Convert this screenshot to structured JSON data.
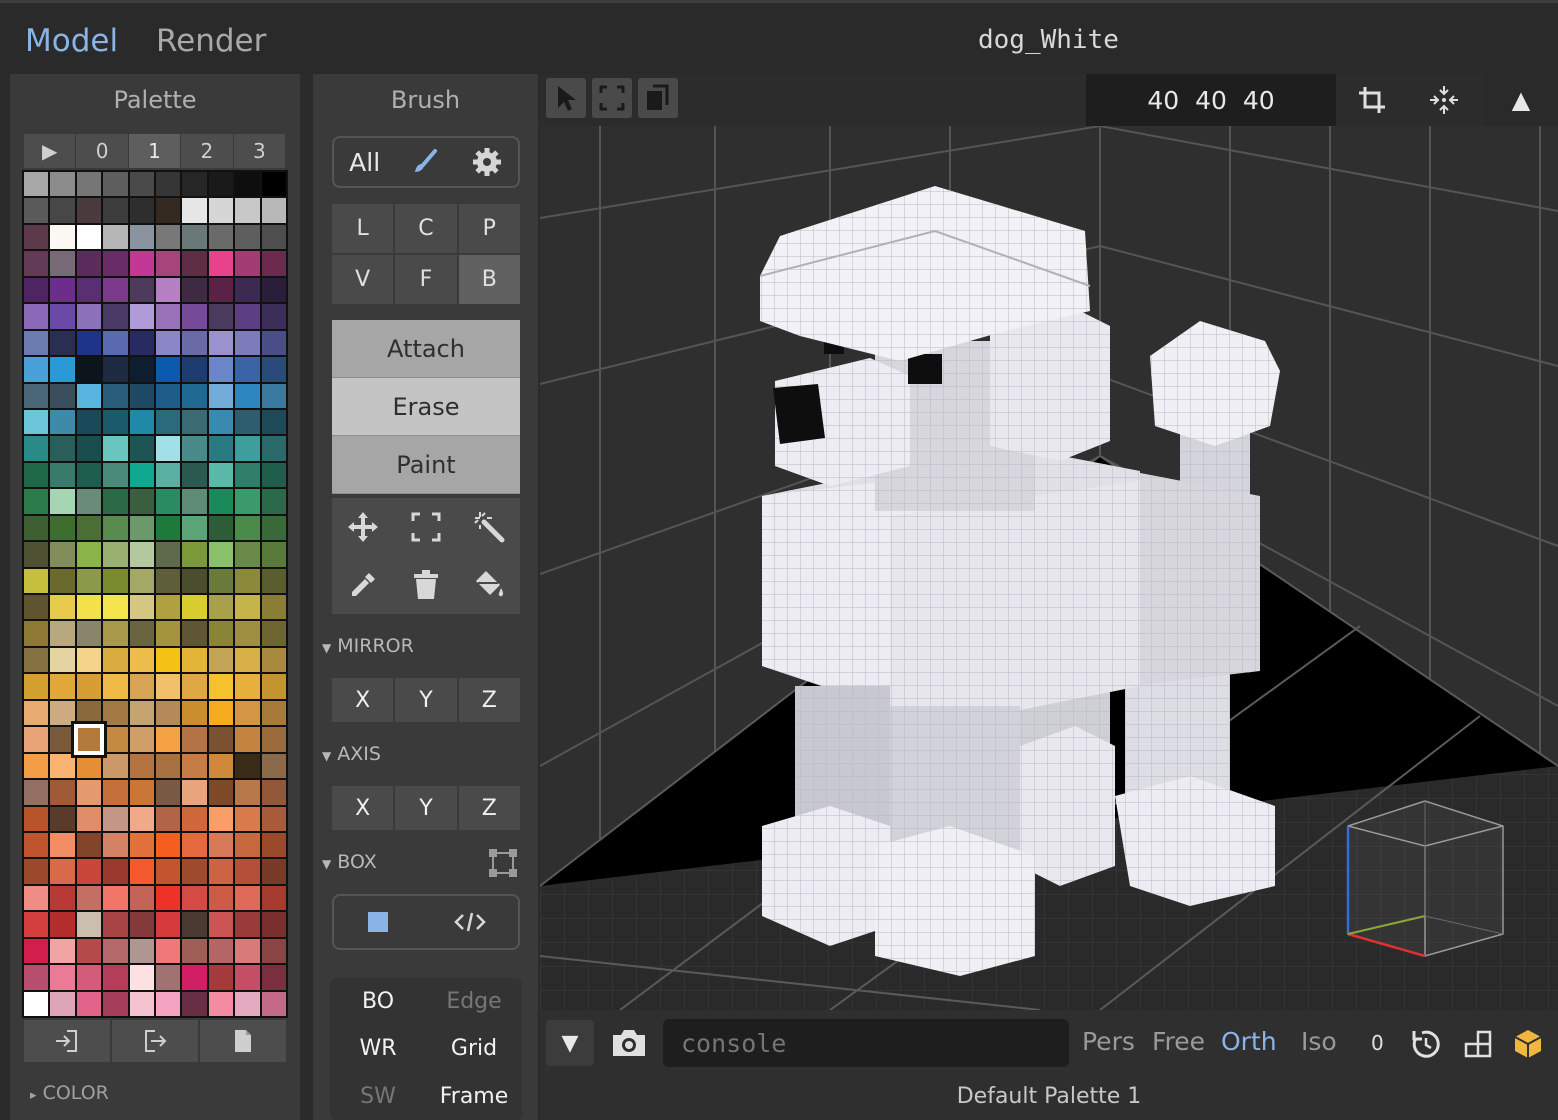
{
  "app": {
    "modes": [
      "Model",
      "Render"
    ],
    "active_mode": "Model",
    "document_title": "dog_White"
  },
  "palette": {
    "title": "Palette",
    "tabs": [
      "▶",
      "0",
      "1",
      "2",
      "3"
    ],
    "active_tab": "1",
    "selected_index": 212,
    "colors": [
      "#a8a8a8",
      "#8c8c8c",
      "#767676",
      "#5e5e5e",
      "#4a4a4a",
      "#363636",
      "#262626",
      "#1a1a1a",
      "#0e0e0e",
      "#000000",
      "#5a5a5a",
      "#474747",
      "#4a3c3c",
      "#3c3c3c",
      "#2e2e2e",
      "#352a22",
      "#e6e6e6",
      "#d6d6d6",
      "#c8c8c8",
      "#b8b8b8",
      "#5c3a4a",
      "#fbf7f2",
      "#ffffff",
      "#b6b6b6",
      "#8a93a0",
      "#787878",
      "#6a7878",
      "#6a6a6a",
      "#5e5e5e",
      "#4e4e4e",
      "#623b56",
      "#776a76",
      "#5c2c5c",
      "#6a2c66",
      "#c23894",
      "#a8447c",
      "#5e2e46",
      "#e8428c",
      "#a43c74",
      "#6c2a4e",
      "#4e2462",
      "#6c2e8a",
      "#5a2e72",
      "#7c3a8c",
      "#4e3a5a",
      "#b680c4",
      "#3e2a42",
      "#5a2246",
      "#3c2a52",
      "#2a1e3a",
      "#8a6ab8",
      "#6a4aa6",
      "#8c72b8",
      "#4a3a66",
      "#b09ad8",
      "#9872b8",
      "#784a9a",
      "#4a3a5e",
      "#5c3e84",
      "#3c2e56",
      "#6c7cb0",
      "#2a2e52",
      "#1e3488",
      "#5a6ab0",
      "#282a62",
      "#8a86c8",
      "#6a6aa8",
      "#9a92cc",
      "#7c7cba",
      "#4a4e88",
      "#4aa0d8",
      "#2a9ad6",
      "#0c141c",
      "#1e2a42",
      "#0e1e30",
      "#0a5ab0",
      "#1e3c72",
      "#6a86c8",
      "#3a64a8",
      "#2a4a7c",
      "#4a6878",
      "#3a4e5e",
      "#5ab4e0",
      "#2a5c7c",
      "#1e4a66",
      "#1e5c8a",
      "#1e6a92",
      "#72aad8",
      "#2e86c0",
      "#3a7aa0",
      "#6ac6d8",
      "#3e8aa8",
      "#1a4a5a",
      "#1a5a6a",
      "#1e8aa8",
      "#2a6a7a",
      "#3a6a72",
      "#3a8ab0",
      "#2e5e6e",
      "#1e4a5a",
      "#2a8a88",
      "#2a5e5a",
      "#1a4e4e",
      "#6ac4c0",
      "#1e5454",
      "#a0e0e6",
      "#4a8a8a",
      "#2a7a82",
      "#3e9e9e",
      "#2a6a6a",
      "#1e6848",
      "#3a7a6a",
      "#1e5e4e",
      "#4a8a7a",
      "#10a890",
      "#5ab0a0",
      "#2a5a50",
      "#5ab8a8",
      "#2e7e6a",
      "#1e5e4a",
      "#2a7a4a",
      "#a4d6b4",
      "#6a8a7a",
      "#2a6a44",
      "#3a5e3e",
      "#2a8a62",
      "#5e8c76",
      "#1a8a5a",
      "#3a9a6a",
      "#2a6a4a",
      "#3e5e34",
      "#3e6e2e",
      "#4a6e36",
      "#5a8a4e",
      "#6a9a6a",
      "#1e7a3a",
      "#5aa478",
      "#2e5e38",
      "#4a8a4a",
      "#3a6a3a",
      "#4e5232",
      "#828e5a",
      "#8ab44a",
      "#9ab070",
      "#b4c8a0",
      "#5e6a4a",
      "#7a9a3a",
      "#8ac06a",
      "#6a8a4a",
      "#5a7a3a",
      "#c4c03e",
      "#6a6a2e",
      "#8a9a4a",
      "#7a8a2e",
      "#a4a866",
      "#5e5e3a",
      "#4a4e2e",
      "#6a7a3a",
      "#8a8a3a",
      "#5a5e2e",
      "#5e5430",
      "#e6cc4a",
      "#f4e04a",
      "#f4e44e",
      "#d6c882",
      "#b0a040",
      "#d8cc2e",
      "#a8a04a",
      "#c4b44a",
      "#8a7e34",
      "#8e7a34",
      "#b8a880",
      "#8a846a",
      "#a8984a",
      "#6a6440",
      "#a4943e",
      "#5e5634",
      "#8a8436",
      "#9e9040",
      "#6e6630",
      "#847242",
      "#e4d4a2",
      "#f4d48a",
      "#d8ac3e",
      "#eebc4a",
      "#f4c214",
      "#e4b436",
      "#c4a456",
      "#d8b04a",
      "#a88a3e",
      "#d4a030",
      "#e0a838",
      "#d89e36",
      "#f0ba46",
      "#d6a454",
      "#f2c06a",
      "#e0a844",
      "#f4c22e",
      "#e8b03a",
      "#c4942e",
      "#e8ac72",
      "#ceaa80",
      "#8a6a3a",
      "#a47a44",
      "#c6a472",
      "#b48a58",
      "#ca8e2e",
      "#f6aa1e",
      "#d49644",
      "#a87a3a",
      "#e8a476",
      "#7a5a3a",
      "#b47a3a",
      "#c48a42",
      "#ce9e66",
      "#f4a244",
      "#b47446",
      "#7a5232",
      "#c48440",
      "#9a6a3a",
      "#f49e46",
      "#fab472",
      "#e68e36",
      "#cc9a6a",
      "#b47442",
      "#a87240",
      "#c67c44",
      "#ce8a3a",
      "#3a2a18",
      "#8a6a4a",
      "#947064",
      "#a05a38",
      "#e49a6e",
      "#c4703a",
      "#ca7636",
      "#7a5a42",
      "#eaa47c",
      "#7e4a2a",
      "#b8784a",
      "#925838",
      "#b8542a",
      "#5a3a2a",
      "#e08e6a",
      "#c49686",
      "#f0aa8a",
      "#b46446",
      "#ce6a3a",
      "#f89e66",
      "#d87a4a",
      "#a85a3a",
      "#c0542e",
      "#f28c64",
      "#84442a",
      "#d48266",
      "#e4703c",
      "#f45e1e",
      "#e46a3e",
      "#d87a5a",
      "#c8683e",
      "#9a4a2a",
      "#9a4a2a",
      "#d86a4a",
      "#c8463a",
      "#9a3a2e",
      "#f45a2e",
      "#c4542e",
      "#a04a2e",
      "#ce6244",
      "#b4503a",
      "#7a3a2a",
      "#f08c88",
      "#b83a34",
      "#c46e64",
      "#f27668",
      "#c46458",
      "#ee3228",
      "#d44a44",
      "#ce5a48",
      "#e06a5a",
      "#a43a30",
      "#d44040",
      "#b42e2e",
      "#ccbeae",
      "#a84444",
      "#843a3a",
      "#d63a3a",
      "#4a3a32",
      "#cc5454",
      "#9a3a3a",
      "#7a2e2e",
      "#d21e4a",
      "#f0a4a4",
      "#b44a4a",
      "#b46a6a",
      "#b09690",
      "#f07878",
      "#a05e56",
      "#b46666",
      "#d87a7a",
      "#8a4444",
      "#b84e6e",
      "#ea7a96",
      "#d45c7a",
      "#b43e5a",
      "#fce0e2",
      "#a07272",
      "#d21e64",
      "#a43a3c",
      "#c44e66",
      "#7a2e3e",
      "#ffffff",
      "#dea4b8",
      "#e2648a",
      "#a43e5a",
      "#f6c2d0",
      "#f4a4c0",
      "#6a2e44",
      "#f48ca4",
      "#e4aac0",
      "#c46a88"
    ],
    "footer_section": "COLOR",
    "color_section_state": "▸"
  },
  "brush": {
    "title": "Brush",
    "target_label": "All",
    "modes": [
      "L",
      "C",
      "P",
      "V",
      "F",
      "B"
    ],
    "active_mode": "B",
    "actions": [
      "Attach",
      "Erase",
      "Paint"
    ],
    "active_action": "Erase",
    "mirror": {
      "label": "MIRROR",
      "axes": [
        "X",
        "Y",
        "Z"
      ]
    },
    "axis": {
      "label": "AXIS",
      "axes": [
        "X",
        "Y",
        "Z"
      ]
    },
    "box": {
      "label": "BOX"
    },
    "caret": "▼",
    "render_toggles": [
      {
        "label": "BO",
        "on": true
      },
      {
        "label": "Edge",
        "on": false
      },
      {
        "label": "WR",
        "on": true
      },
      {
        "label": "Grid",
        "on": true
      },
      {
        "label": "SW",
        "on": false
      },
      {
        "label": "Frame",
        "on": true
      }
    ]
  },
  "viewport": {
    "dimensions": "40 40 40",
    "collapse_glyph": "▲",
    "menu_glyph": "▼",
    "console_placeholder": "console",
    "projections": [
      "Pers",
      "Free",
      "Orth",
      "Iso"
    ],
    "active_projection": "Orth",
    "zoom_value": "0",
    "palette_name": "Default Palette 1",
    "accent_color": "#8ab4e8"
  }
}
